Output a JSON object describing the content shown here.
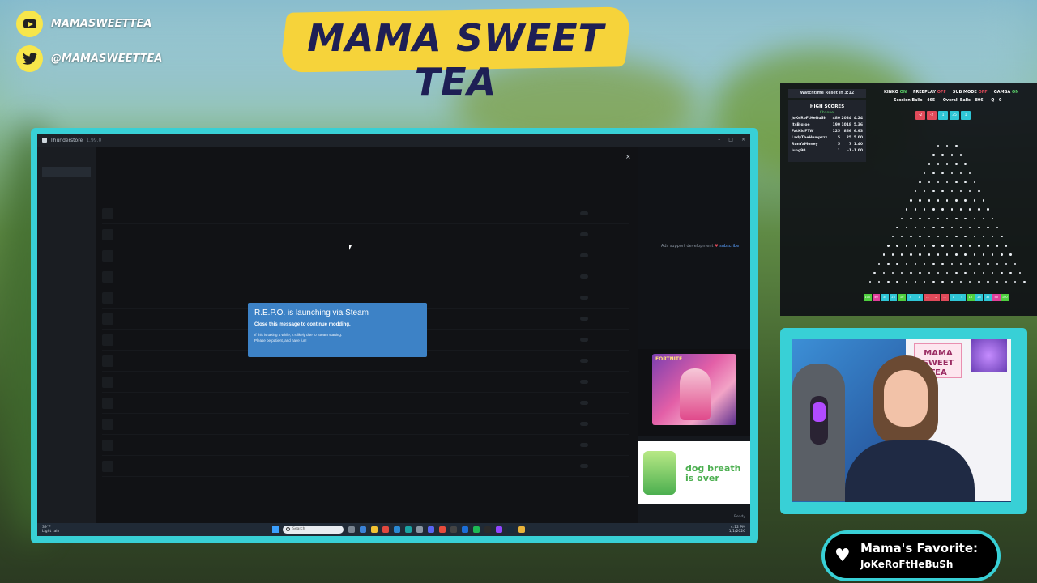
{
  "socials": {
    "youtube": "MAMASWEETTEA",
    "twitter": "@MAMASWEETTEA"
  },
  "banner": {
    "title": "MAMA SWEET TEA"
  },
  "app": {
    "name": "Thunderstore",
    "version": "1.99.0"
  },
  "dialog": {
    "title": "R.E.P.O. is launching via Steam",
    "subtitle": "Close this message to continue modding.",
    "note_line1": "If this is taking a while, it's likely due to Steam starting.",
    "note_line2": "Please be patient, and have fun!",
    "close_symbol": "×"
  },
  "ads": {
    "support_text": "Ads support development",
    "subscribe_text": "subscribe",
    "ad1_logo": "FORTNITE",
    "ad2_text_line1": "dog breath",
    "ad2_text_line2": "is over"
  },
  "taskbar": {
    "weather_temp": "39°F",
    "weather_desc": "Light rain",
    "search_placeholder": "Search",
    "time": "4:12 PM",
    "date": "1/1/2026",
    "status": "Ready"
  },
  "plinko": {
    "watchtime": "Watchtime Reset in 3:12",
    "flags": [
      {
        "label": "KINKO",
        "state": "ON"
      },
      {
        "label": "FREEPLAY",
        "state": "OFF"
      },
      {
        "label": "SUB MODE",
        "state": "OFF"
      },
      {
        "label": "GAMBA",
        "state": "ON"
      }
    ],
    "session_balls_label": "Session Balls",
    "session_balls": "465",
    "overall_balls_label": "Overall Balls",
    "overall_balls": "806",
    "q_label": "Q",
    "q_value": "0",
    "high_scores_title": "HIGH SCORES",
    "high_scores_sub": "Channel",
    "high_scores": [
      {
        "name": "JoKeRoFtHeBuSh",
        "a": "480",
        "b": "2034",
        "c": "4.24"
      },
      {
        "name": "ItsBigJoe",
        "a": "190",
        "b": "1018",
        "c": "5.36"
      },
      {
        "name": "FatKidFTW",
        "a": "125",
        "b": "866",
        "c": "6.93"
      },
      {
        "name": "LadyTheHumpzzz",
        "a": "5",
        "b": "25",
        "c": "5.00"
      },
      {
        "name": "RunYaMoney",
        "a": "5",
        "b": "7",
        "c": "1.40"
      },
      {
        "name": "lung90",
        "a": "1",
        "b": "-1",
        "c": "-1.00"
      }
    ],
    "chips": [
      {
        "text": "-2",
        "color": "#e04a5a"
      },
      {
        "text": "-2",
        "color": "#e04a5a"
      },
      {
        "text": "1",
        "color": "#2fc6d6"
      },
      {
        "text": "35",
        "color": "#2fc6d6"
      },
      {
        "text": "1",
        "color": "#2fc6d6"
      }
    ],
    "buckets": [
      {
        "t": "100",
        "c": "#4fcf3f"
      },
      {
        "t": "50",
        "c": "#e0409a"
      },
      {
        "t": "35",
        "c": "#2fc6d6"
      },
      {
        "t": "25",
        "c": "#2fc6d6"
      },
      {
        "t": "10",
        "c": "#4fcf3f"
      },
      {
        "t": "5",
        "c": "#2fc6d6"
      },
      {
        "t": "1",
        "c": "#2fc6d6"
      },
      {
        "t": "-1",
        "c": "#e04a5a"
      },
      {
        "t": "-2",
        "c": "#e04a5a"
      },
      {
        "t": "-1",
        "c": "#e04a5a"
      },
      {
        "t": "1",
        "c": "#2fc6d6"
      },
      {
        "t": "5",
        "c": "#2fc6d6"
      },
      {
        "t": "10",
        "c": "#4fcf3f"
      },
      {
        "t": "25",
        "c": "#2fc6d6"
      },
      {
        "t": "35",
        "c": "#2fc6d6"
      },
      {
        "t": "50",
        "c": "#e0409a"
      },
      {
        "t": "100",
        "c": "#4fcf3f"
      }
    ]
  },
  "cam": {
    "sign_line1": "MAMA",
    "sign_line2": "SWEET TEA"
  },
  "favorite": {
    "heading": "Mama's Favorite:",
    "name": "JoKeRoFtHeBuSh"
  }
}
